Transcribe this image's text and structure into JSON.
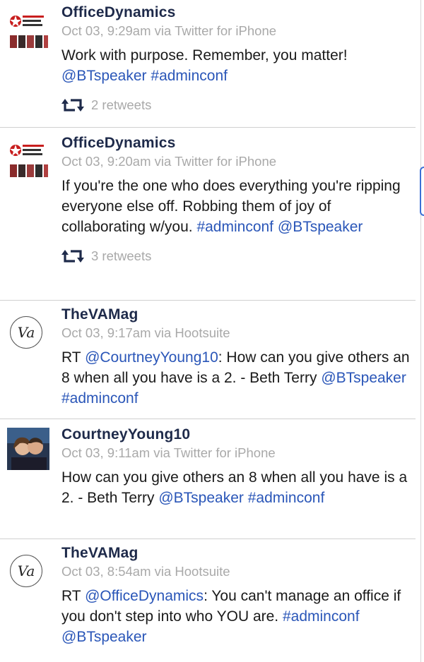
{
  "tweets": [
    {
      "user": "OfficeDynamics",
      "meta": "Oct 03, 9:29am via Twitter for iPhone",
      "segments": [
        {
          "t": "Work with purpose. Remember, you matter! "
        },
        {
          "t": "@BTspeaker",
          "link": true
        },
        {
          "t": " "
        },
        {
          "t": "#adminconf",
          "link": true
        }
      ],
      "retweets": "2 retweets",
      "avatar": "officedynamics-logo"
    },
    {
      "user": "OfficeDynamics",
      "meta": "Oct 03, 9:20am via Twitter for iPhone",
      "segments": [
        {
          "t": "If you're the one who does everything you're ripping everyone else off. Robbing them of joy of collaborating w/you. "
        },
        {
          "t": "#adminconf",
          "link": true
        },
        {
          "t": " "
        },
        {
          "t": "@BTspeaker",
          "link": true
        }
      ],
      "retweets": "3 retweets",
      "avatar": "officedynamics-logo"
    },
    {
      "user": "TheVAMag",
      "meta": "Oct 03, 9:17am via Hootsuite",
      "segments": [
        {
          "t": "RT "
        },
        {
          "t": "@CourtneyYoung10",
          "link": true
        },
        {
          "t": ": How can you give others an 8 when all you have is a 2. - Beth Terry "
        },
        {
          "t": "@BTspeaker",
          "link": true
        },
        {
          "t": " "
        },
        {
          "t": "#adminconf",
          "link": true
        }
      ],
      "retweets": "",
      "avatar": "va-logo"
    },
    {
      "user": "CourtneyYoung10",
      "meta": "Oct 03, 9:11am via Twitter for iPhone",
      "segments": [
        {
          "t": "How can you give others an 8 when all you have is a 2. - Beth Terry "
        },
        {
          "t": "@BTspeaker",
          "link": true
        },
        {
          "t": " "
        },
        {
          "t": "#adminconf",
          "link": true
        }
      ],
      "retweets": "",
      "avatar": "user-photo"
    },
    {
      "user": "TheVAMag",
      "meta": "Oct 03, 8:54am via Hootsuite",
      "segments": [
        {
          "t": "RT "
        },
        {
          "t": "@OfficeDynamics",
          "link": true
        },
        {
          "t": ": You can't manage an office if you don't step into who YOU are. "
        },
        {
          "t": "#adminconf",
          "link": true
        },
        {
          "t": " "
        },
        {
          "t": "@BTspeaker",
          "link": true
        }
      ],
      "retweets": "",
      "avatar": "va-logo"
    }
  ],
  "va_logo_text": "Va",
  "colors": {
    "link": "#2a56b8",
    "username": "#1e2a4a",
    "meta": "#a9a9a9",
    "divider": "#d0d0d0"
  }
}
